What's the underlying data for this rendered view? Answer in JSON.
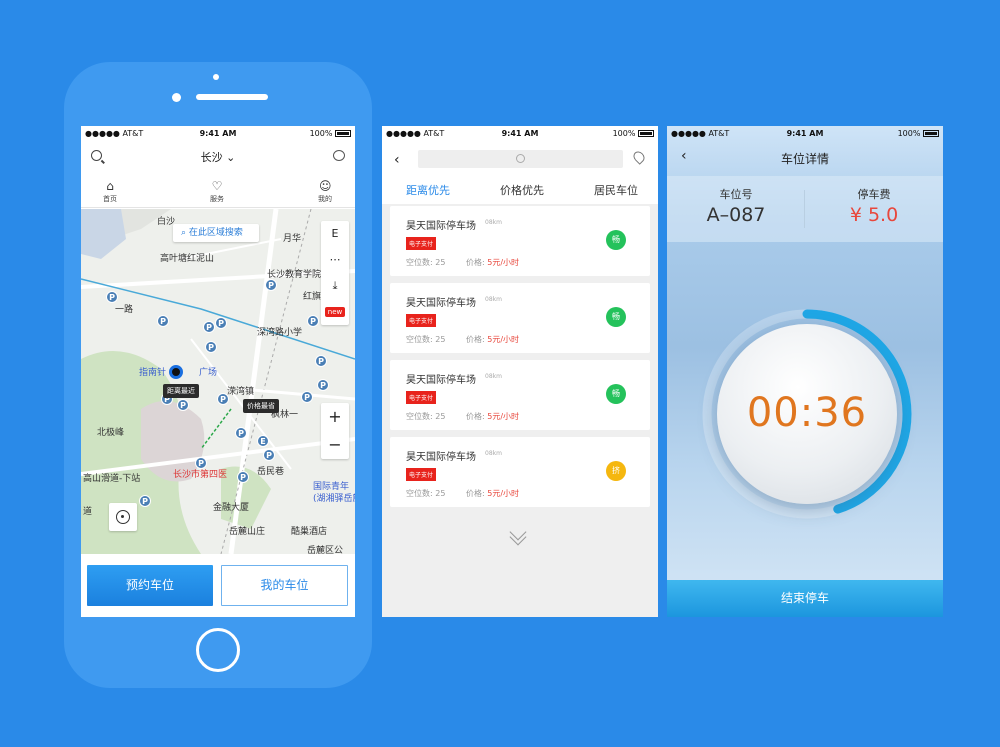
{
  "status_bar": {
    "carrier": "●●●●● AT&T",
    "time": "9:41 AM",
    "battery": "100%"
  },
  "screen1": {
    "city": "长沙",
    "nav": [
      {
        "label": "首页",
        "icon": "home-icon"
      },
      {
        "label": "服务",
        "icon": "heart-icon"
      },
      {
        "label": "我的",
        "icon": "user-icon"
      }
    ],
    "map_search": "在此区域搜索",
    "tools": [
      "E",
      "⋯",
      "⤓",
      "new"
    ],
    "zoom_in": "+",
    "zoom_out": "−",
    "labels": {
      "l1": "高叶塘红泥山",
      "l2": "长沙教育学院",
      "l3": "一路",
      "l4": "深湾路小学",
      "l5": "指南针",
      "l6": "广场",
      "l7": "溁湾镇",
      "l8": "北极峰",
      "l9": "枫林一",
      "l10": "高山滑道-下站",
      "l11": "长沙市第四医",
      "l12": "岳民巷",
      "l13": "国际青年",
      "l14": "(湖湘驿岳麓",
      "l15": "道",
      "l16": "金融大厦",
      "l17": "岳麓山庄",
      "l18": "酷巢酒店",
      "l19": "岳麓区公",
      "l20": "白沙",
      "l21": "红旗",
      "l22": "月华"
    },
    "tag_nearest": "距离最近",
    "tag_cheapest": "价格最省",
    "btn_reserve": "预约车位",
    "btn_mine": "我的车位"
  },
  "screen2": {
    "tabs": [
      "距离优先",
      "价格优先",
      "居民车位"
    ],
    "lots": [
      {
        "name": "昊天国际停车场",
        "dist": "08km",
        "pay": "电子支付",
        "spaces_label": "空位数:",
        "spaces": "25",
        "price_label": "价格:",
        "price": "5元/小时",
        "status": "畅",
        "status_color": "#24c25b"
      },
      {
        "name": "昊天国际停车场",
        "dist": "08km",
        "pay": "电子支付",
        "spaces_label": "空位数:",
        "spaces": "25",
        "price_label": "价格:",
        "price": "5元/小时",
        "status": "畅",
        "status_color": "#24c25b"
      },
      {
        "name": "昊天国际停车场",
        "dist": "08km",
        "pay": "电子支付",
        "spaces_label": "空位数:",
        "spaces": "25",
        "price_label": "价格:",
        "price": "5元/小时",
        "status": "畅",
        "status_color": "#24c25b"
      },
      {
        "name": "昊天国际停车场",
        "dist": "08km",
        "pay": "电子支付",
        "spaces_label": "空位数:",
        "spaces": "25",
        "price_label": "价格:",
        "price": "5元/小时",
        "status": "挤",
        "status_color": "#f5b70f"
      }
    ]
  },
  "screen3": {
    "title": "车位详情",
    "spot_label": "车位号",
    "spot_value": "A–087",
    "fee_label": "停车费",
    "fee_value": "¥ 5.0",
    "timer": "00:36",
    "timer_progress": 0.45,
    "end_button": "结束停车"
  },
  "colors": {
    "accent": "#2a8ae8",
    "price": "#e8473c",
    "timer": "#e0761f"
  }
}
